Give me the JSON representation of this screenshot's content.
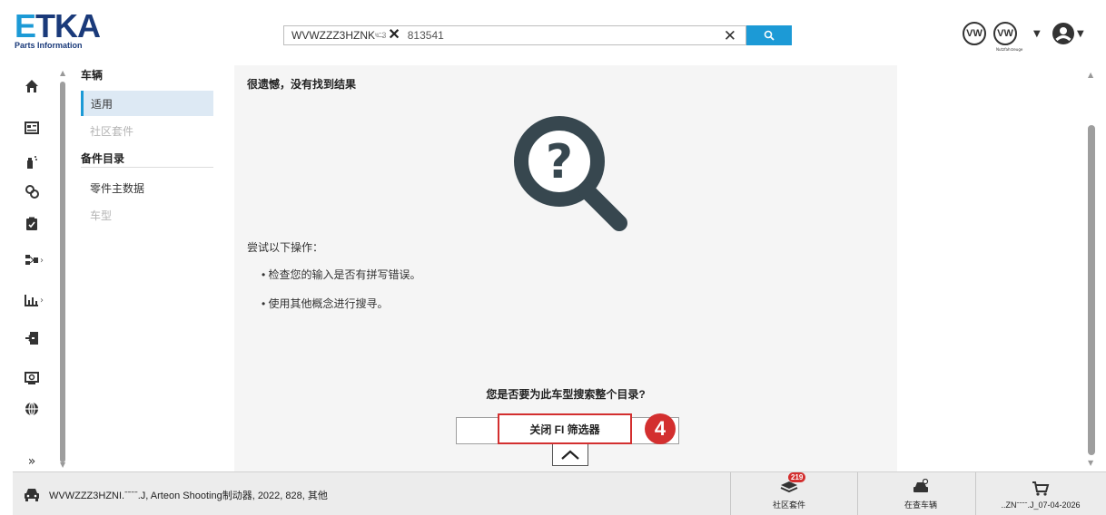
{
  "header": {
    "logo_main_e": "E",
    "logo_main_rest": "TKA",
    "logo_sub": "Parts Information",
    "search_chip": "WVWZZZ3HZNK",
    "search_chip_masked": "ʷ̶̶̶ˉ̶3",
    "search_query": "813541",
    "brand_1": "VW",
    "brand_2": "VW",
    "brand_2_sub": "Nutzfahrzeuge"
  },
  "sidebar": {
    "section_vehicle": "车辆",
    "items_vehicle": [
      {
        "label": "适用",
        "state": "active"
      },
      {
        "label": "社区套件",
        "state": "disabled"
      }
    ],
    "section_catalog": "备件目录",
    "items_catalog": [
      {
        "label": "零件主数据",
        "state": "normal"
      },
      {
        "label": "车型",
        "state": "disabled"
      }
    ]
  },
  "main": {
    "sorry": "很遗憾，没有找到结果",
    "try_title": "尝试以下操作：",
    "bullets": [
      "检查您的输入是否有拼写错误。",
      "使用其他概念进行搜寻。"
    ],
    "question": "您是否要为此车型搜索整个目录?",
    "filter_button": "关闭 FI 筛选器",
    "annotation_number": "4"
  },
  "footer": {
    "vehicle_text": "WVWZZZ3HZNI.ˉˉˉˉ.J, Arteon Shooting制动器, 2022, 828, 其他",
    "community_count": "219",
    "community_label": "社区套件",
    "vehicle_search_label": "在查车辆",
    "cart_label": "..ZNˉˉˉˉ.J_07-04-2026"
  },
  "colors": {
    "accent": "#1c9ad6",
    "logo_dark": "#1a3a7a",
    "highlight_red": "#d32f2f",
    "icon_dark": "#37474f"
  }
}
